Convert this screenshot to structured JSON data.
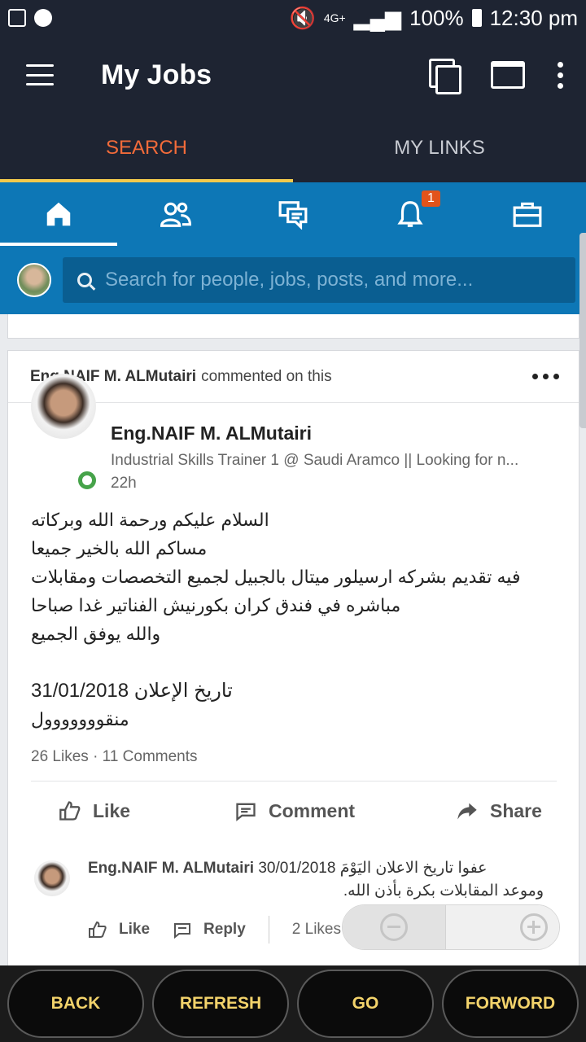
{
  "status_bar": {
    "network": "4G+",
    "battery": "100%",
    "time": "12:30 pm"
  },
  "app_bar": {
    "title": "My Jobs"
  },
  "tabs": [
    {
      "label": "SEARCH",
      "active": true
    },
    {
      "label": "MY LINKS",
      "active": false
    }
  ],
  "nav": {
    "items": [
      "home-icon",
      "people-icon",
      "messages-icon",
      "notifications-icon",
      "jobs-briefcase-icon"
    ],
    "notification_badge": "1"
  },
  "search": {
    "placeholder": "Search for people, jobs, posts, and more..."
  },
  "card": {
    "header_name": "Eng.NAIF M. ALMutairi",
    "header_action": "commented on this",
    "author_name": "Eng.NAIF M. ALMutairi",
    "author_title": "Industrial Skills Trainer 1 @ Saudi Aramco || Looking for n...",
    "time": "22h",
    "body_lines": [
      "السلام عليكم ورحمة الله وبركاته",
      "مساكم الله بالخير جميعا",
      "فيه تقديم بشركه ارسيلور ميتال بالجبيل لجميع التخصصات ومقابلات",
      "مباشره في فندق كران بكورنيش الفناتير غدا صباحا",
      "والله يوفق الجميع"
    ],
    "body_lines_2": [
      "تاريخ الإعلان 31/01/2018",
      "منقووووووول"
    ],
    "likes": "26 Likes",
    "comments": "11 Comments",
    "like_label": "Like",
    "comment_label": "Comment",
    "share_label": "Share"
  },
  "comment": {
    "name": "Eng.NAIF M. ALMutairi",
    "text_line1": "عفوا تاريخ الاعلان اليَوْمَ 30/01/2018",
    "text_line2": "وموعد المقابلات بكرة بأذن الله.",
    "like_label": "Like",
    "reply_label": "Reply",
    "likes": "2 Likes"
  },
  "bottom_bar": {
    "back": "BACK",
    "refresh": "REFRESH",
    "go": "GO",
    "forward": "FORWORD"
  }
}
